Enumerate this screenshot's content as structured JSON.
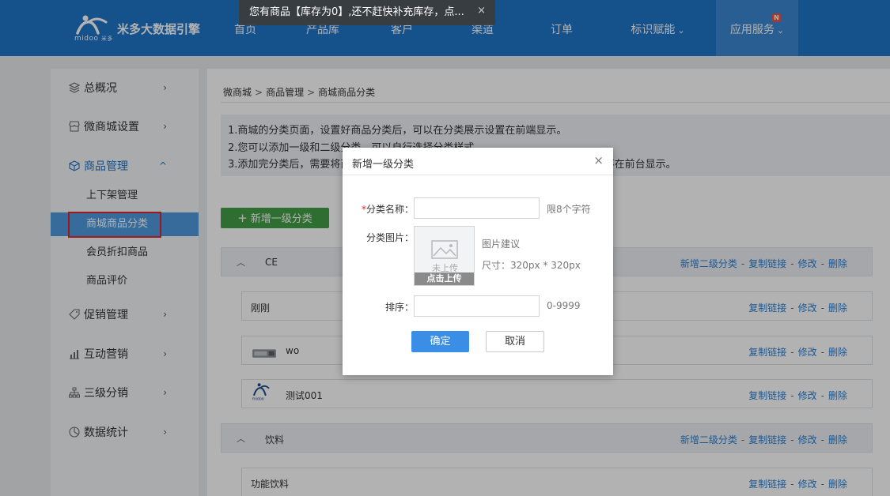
{
  "brand": {
    "logo_text": "midoo",
    "logo_sub": "米多",
    "name": "米多大数据引擎"
  },
  "nav": [
    {
      "label": "首页",
      "dropdown": false
    },
    {
      "label": "产品库",
      "dropdown": false
    },
    {
      "label": "客户",
      "dropdown": false
    },
    {
      "label": "渠道",
      "dropdown": false
    },
    {
      "label": "订单",
      "dropdown": false
    },
    {
      "label": "标识赋能",
      "dropdown": true
    },
    {
      "label": "应用服务",
      "dropdown": true,
      "badge": "N",
      "active": true
    }
  ],
  "toast": {
    "message": "您有商品【库存为0】,还不赶快补充库存，点...",
    "close": "×"
  },
  "sidebar": {
    "items": [
      {
        "label": "总概况",
        "icon": "layers-icon",
        "arrow": "›"
      },
      {
        "label": "微商城设置",
        "icon": "storefront-icon",
        "arrow": "›"
      },
      {
        "label": "商品管理",
        "icon": "box-icon",
        "arrow": "^",
        "open": true
      },
      {
        "label": "促销管理",
        "icon": "tag-icon",
        "arrow": "›"
      },
      {
        "label": "互动营销",
        "icon": "bar-chart-icon",
        "arrow": "›"
      },
      {
        "label": "三级分销",
        "icon": "hierarchy-icon",
        "arrow": "›"
      },
      {
        "label": "数据统计",
        "icon": "pie-chart-icon",
        "arrow": "›"
      }
    ],
    "sub_items": [
      {
        "label": "上下架管理"
      },
      {
        "label": "商城商品分类",
        "active": true
      },
      {
        "label": "会员折扣商品"
      },
      {
        "label": "商品评价"
      }
    ]
  },
  "breadcrumb": [
    "微商城",
    "商品管理",
    "商城商品分类"
  ],
  "breadcrumb_sep": ">",
  "tips": [
    "1.商城的分类页面，设置好商品分类后，可以在分类展示设置在前端显示。",
    "2.您可以添加一级和二级分类，可以自行选择分类样式",
    "3.添加完分类后，需要将商品关联到对应的分类，当分类关联的上架产品数为0时，不在前台显示。"
  ],
  "add_button": {
    "plus": "+",
    "label": "新增一级分类"
  },
  "actions": {
    "add_sub": "新增二级分类",
    "copy_link": "复制链接",
    "edit": "修改",
    "delete": "删除",
    "sep": "-"
  },
  "categories": [
    {
      "name": "CE",
      "level": 1
    },
    {
      "name": "刚刚",
      "level": 2
    },
    {
      "name": "wo",
      "level": 2,
      "thumb": "device-image"
    },
    {
      "name": "测试001",
      "level": 2,
      "thumb": "midoo-logo"
    },
    {
      "name": "饮料",
      "level": 1
    },
    {
      "name": "功能饮料",
      "level": 2
    }
  ],
  "modal": {
    "title": "新增一级分类",
    "close": "×",
    "name_label": "分类名称：",
    "name_required": "*",
    "name_value": "",
    "name_hint": "限8个字符",
    "image_label": "分类图片：",
    "upload_status": "未上传",
    "upload_button": "点击上传",
    "image_hint_title": "图片建议",
    "image_hint_size": "尺寸：320px * 320px",
    "sort_label": "排序：",
    "sort_value": "",
    "sort_hint": "0-9999",
    "ok": "确定",
    "cancel": "取消"
  },
  "colors": {
    "primary": "#1f74c8",
    "green": "#43a047",
    "link": "#2a7fd4",
    "danger": "#e0262b"
  }
}
